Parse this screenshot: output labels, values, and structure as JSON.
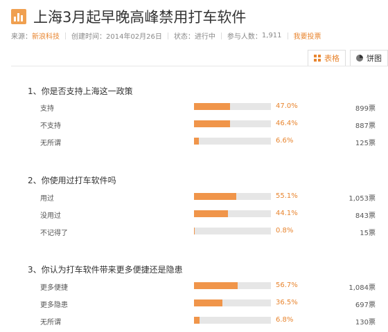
{
  "header": {
    "title": "上海3月起早晚高峰禁用打车软件",
    "source_label": "来源：",
    "source_value": "新浪科技",
    "created_label": "创建时间：",
    "created_value": "2014年02月26日",
    "status_label": "状态：",
    "status_value": "进行中",
    "participants_label": "参与人数：",
    "participants_value": "1,911",
    "vote_link": "我要投票"
  },
  "tabs": [
    {
      "label": "表格",
      "icon": "grid-icon",
      "active": true
    },
    {
      "label": "饼图",
      "icon": "pie-icon",
      "active": false
    }
  ],
  "colors": {
    "accent": "#e8852f",
    "bar_fill": "#f0954a",
    "bar_track": "#e6e6e6"
  },
  "questions": [
    {
      "title": "1、你是否支持上海这一政策",
      "options": [
        {
          "label": "支持",
          "pct": "47.0%",
          "value": 47.0,
          "votes": "899票"
        },
        {
          "label": "不支持",
          "pct": "46.4%",
          "value": 46.4,
          "votes": "887票"
        },
        {
          "label": "无所谓",
          "pct": "6.6%",
          "value": 6.6,
          "votes": "125票"
        }
      ]
    },
    {
      "title": "2、你使用过打车软件吗",
      "options": [
        {
          "label": "用过",
          "pct": "55.1%",
          "value": 55.1,
          "votes": "1,053票"
        },
        {
          "label": "没用过",
          "pct": "44.1%",
          "value": 44.1,
          "votes": "843票"
        },
        {
          "label": "不记得了",
          "pct": "0.8%",
          "value": 0.8,
          "votes": "15票"
        }
      ]
    },
    {
      "title": "3、你认为打车软件带来更多便捷还是隐患",
      "options": [
        {
          "label": "更多便捷",
          "pct": "56.7%",
          "value": 56.7,
          "votes": "1,084票"
        },
        {
          "label": "更多隐患",
          "pct": "36.5%",
          "value": 36.5,
          "votes": "697票"
        },
        {
          "label": "无所谓",
          "pct": "6.8%",
          "value": 6.8,
          "votes": "130票"
        }
      ]
    }
  ]
}
